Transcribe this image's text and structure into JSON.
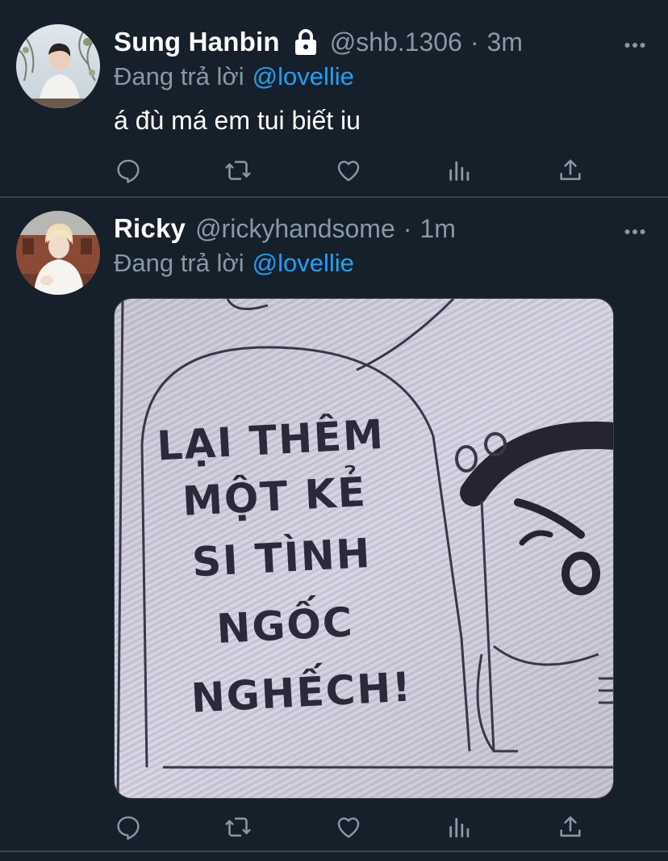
{
  "colors": {
    "background": "#15202b",
    "divider": "#38444d",
    "secondary_text": "#8899a6",
    "mention": "#1da1f2",
    "primary_text": "#ffffff"
  },
  "tweets": [
    {
      "display_name": "Sung Hanbin",
      "protected_icon": "lock-icon",
      "handle": "@shb.1306",
      "separator": "·",
      "time": "3m",
      "replying_to_label": "Đang trả lời",
      "replying_to_handle": "@lovellie",
      "text": "á đù má em tui biết iu",
      "avatar_icon": "avatar-photo",
      "actions": [
        "reply-icon",
        "retweet-icon",
        "like-icon",
        "analytics-icon",
        "share-icon"
      ]
    },
    {
      "display_name": "Ricky",
      "handle": "@rickyhandsome",
      "separator": "·",
      "time": "1m",
      "replying_to_label": "Đang trả lời",
      "replying_to_handle": "@lovellie",
      "avatar_icon": "avatar-photo",
      "media": {
        "type": "manga-panel-image",
        "lines": [
          "LẠI THÊM",
          "MỘT KẺ",
          "SI TÌNH",
          "NGỐC",
          "NGHẾCH!"
        ]
      },
      "actions": [
        "reply-icon",
        "retweet-icon",
        "like-icon",
        "analytics-icon",
        "share-icon"
      ]
    }
  ]
}
